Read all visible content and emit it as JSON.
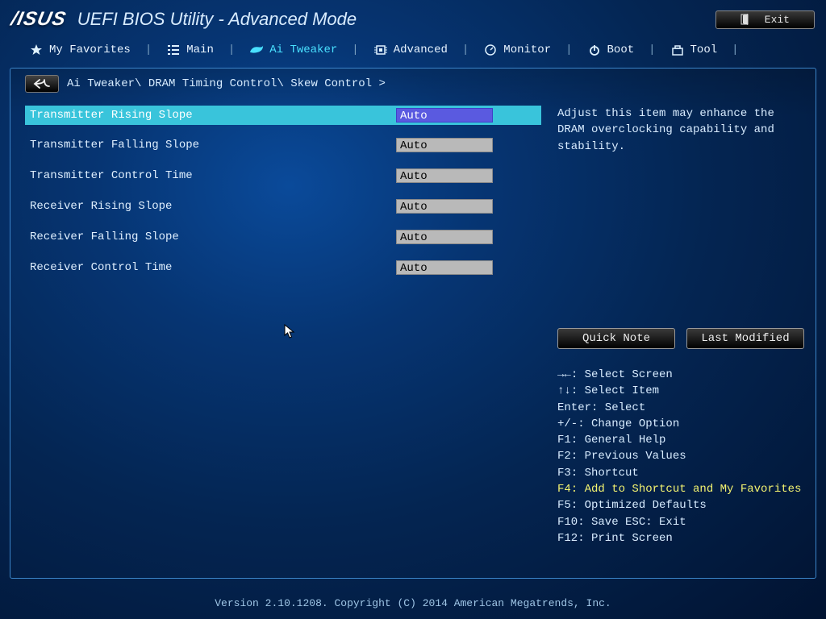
{
  "header": {
    "logo": "/ISUS",
    "title": "UEFI BIOS Utility - Advanced Mode",
    "exit": "Exit"
  },
  "tabs": {
    "favorites": "My Favorites",
    "main": "Main",
    "tweaker": "Ai Tweaker",
    "advanced": "Advanced",
    "monitor": "Monitor",
    "boot": "Boot",
    "tool": "Tool"
  },
  "breadcrumb": "Ai Tweaker\\ DRAM Timing Control\\ Skew Control >",
  "settings": [
    {
      "label": "Transmitter Rising Slope",
      "value": "Auto",
      "selected": true
    },
    {
      "label": "Transmitter Falling Slope",
      "value": "Auto",
      "selected": false
    },
    {
      "label": "Transmitter Control Time",
      "value": "Auto",
      "selected": false
    },
    {
      "label": "Receiver Rising Slope",
      "value": "Auto",
      "selected": false
    },
    {
      "label": "Receiver Falling Slope",
      "value": "Auto",
      "selected": false
    },
    {
      "label": "Receiver Control Time",
      "value": "Auto",
      "selected": false
    }
  ],
  "help": "Adjust this item may enhance the DRAM overclocking capability and stability.",
  "side_buttons": {
    "quick_note": "Quick Note",
    "last_modified": "Last Modified"
  },
  "key_hints": {
    "l1a": "→←",
    "l1b": ": Select Screen",
    "l2a": "↑↓",
    "l2b": ": Select Item",
    "l3": "Enter: Select",
    "l4": "+/-: Change Option",
    "l5": "F1: General Help",
    "l6": "F2: Previous Values",
    "l7": "F3: Shortcut",
    "l8": "F4: Add to Shortcut and My Favorites",
    "l9": "F5: Optimized Defaults",
    "l10": "F10: Save  ESC: Exit",
    "l11": "F12: Print Screen"
  },
  "footer": "Version 2.10.1208. Copyright (C) 2014 American Megatrends, Inc."
}
